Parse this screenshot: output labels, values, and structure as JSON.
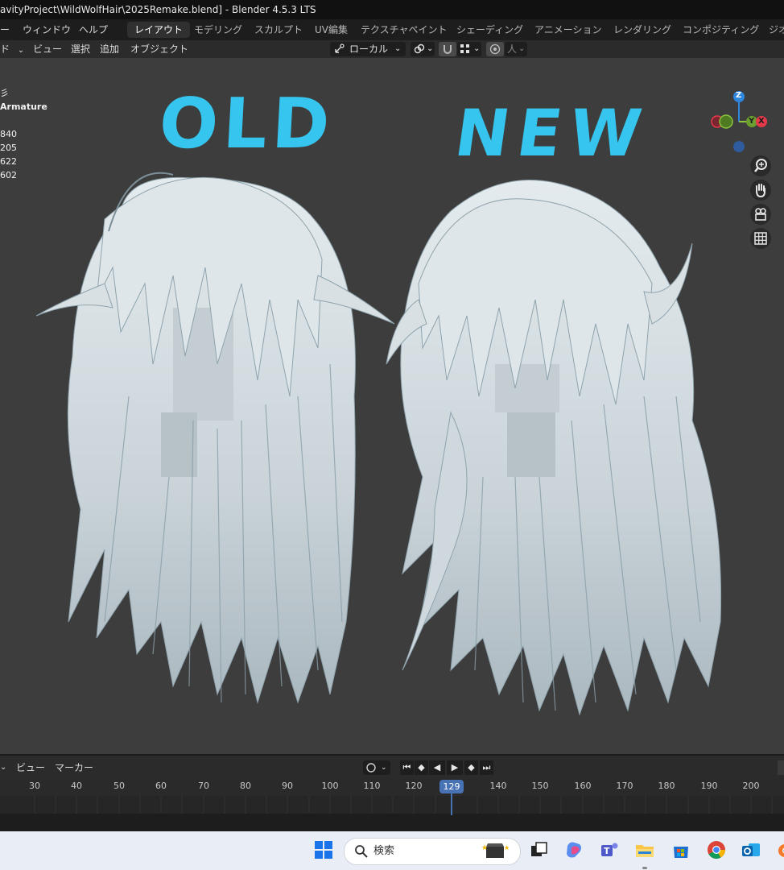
{
  "titlebar": {
    "title": "avityProject\\WildWolfHair\\2025Remake.blend] - Blender 4.5.3 LTS"
  },
  "menubar": {
    "items": [
      "ー",
      "ウィンドウ",
      "ヘルプ"
    ],
    "workspaces": [
      "レイアウト",
      "モデリング",
      "スカルプト",
      "UV編集",
      "テクスチャペイント",
      "シェーディング",
      "アニメーション",
      "レンダリング",
      "コンポジティング",
      "ジオ"
    ],
    "active_workspace": "レイアウト"
  },
  "viewport_header": {
    "mode_label": "ド",
    "menus": [
      "ビュー",
      "選択",
      "追加",
      "オブジェクト"
    ],
    "transform_orientation": "ローカル",
    "pivot_label": "人"
  },
  "viewport": {
    "stats": {
      "mode": "彡",
      "object": "Armature",
      "values": [
        "840",
        "205",
        "622",
        "602"
      ]
    },
    "annotations": {
      "left": "OLD",
      "right": "NEW"
    },
    "gizmo": {
      "z": "Z",
      "y": "Y",
      "x": "X"
    },
    "colors": {
      "background": "#3d3d3d",
      "annotation": "#35c5ee",
      "hair": "#dfe6ea",
      "hair_shadow": "#7f98a4"
    },
    "nav_icons": [
      "zoom-icon",
      "hand-pan-icon",
      "camera-icon",
      "grid-icon"
    ]
  },
  "timeline": {
    "menus": [
      "ビュー",
      "マーカー"
    ],
    "ticks": [
      "30",
      "40",
      "50",
      "60",
      "70",
      "80",
      "90",
      "100",
      "110",
      "120",
      "140",
      "150",
      "160",
      "170",
      "180",
      "190",
      "200"
    ],
    "current_frame": "129",
    "playhead_color": "#4772b3"
  },
  "taskbar": {
    "search_label": "検索",
    "apps": [
      "windows-start-icon",
      "task-view-icon",
      "copilot-icon",
      "teams-icon",
      "file-explorer-icon",
      "store-icon",
      "chrome-icon",
      "outlook-icon",
      "blender-icon"
    ]
  }
}
